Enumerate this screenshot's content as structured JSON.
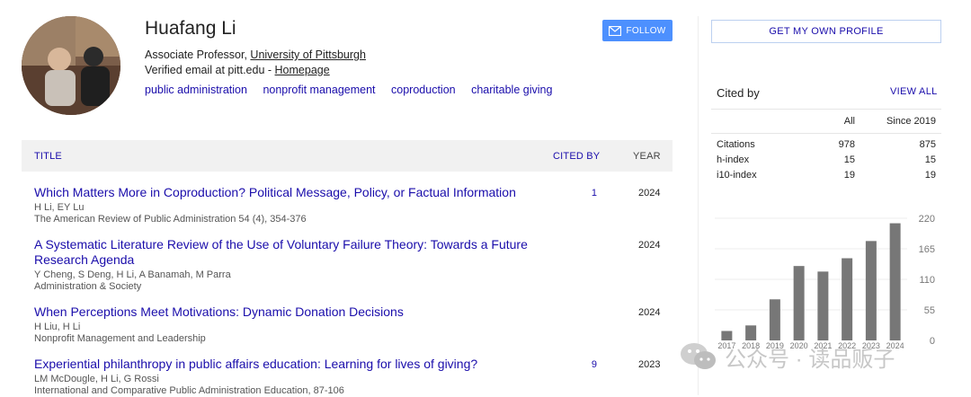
{
  "profile": {
    "name": "Huafang Li",
    "title_prefix": "Associate Professor, ",
    "university": "University of Pittsburgh",
    "email_prefix": "Verified email at pitt.edu - ",
    "homepage": "Homepage",
    "interests": [
      "public administration",
      "nonprofit management",
      "coproduction",
      "charitable giving"
    ],
    "follow_label": "FOLLOW"
  },
  "table": {
    "title_header": "TITLE",
    "cited_header": "CITED BY",
    "year_header": "YEAR",
    "rows": [
      {
        "title": "Which Matters More in Coproduction? Political Message, Policy, or Factual Information",
        "authors": "H Li, EY Lu",
        "venue": "The American Review of Public Administration 54 (4), 354-376",
        "cited": "1",
        "year": "2024"
      },
      {
        "title": "A Systematic Literature Review of the Use of Voluntary Failure Theory: Towards a Future Research Agenda",
        "authors": "Y Cheng, S Deng, H Li, A Banamah, M Parra",
        "venue": "Administration & Society",
        "cited": "",
        "year": "2024"
      },
      {
        "title": "When Perceptions Meet Motivations: Dynamic Donation Decisions",
        "authors": "H Liu, H Li",
        "venue": "Nonprofit Management and Leadership",
        "cited": "",
        "year": "2024"
      },
      {
        "title": "Experiential philanthropy in public affairs education: Learning for lives of giving?",
        "authors": "LM McDougle, H Li, G Rossi",
        "venue": "International and Comparative Public Administration Education, 87-106",
        "cited": "9",
        "year": "2023"
      }
    ]
  },
  "sidebar": {
    "own_profile_label": "GET MY OWN PROFILE",
    "cited_by_label": "Cited by",
    "view_all_label": "VIEW ALL",
    "col_all": "All",
    "col_since": "Since 2019",
    "stats": [
      {
        "label": "Citations",
        "all": "978",
        "since": "875"
      },
      {
        "label": "h-index",
        "all": "15",
        "since": "15"
      },
      {
        "label": "i10-index",
        "all": "19",
        "since": "19"
      }
    ]
  },
  "chart_data": {
    "type": "bar",
    "categories": [
      "2017",
      "2018",
      "2019",
      "2020",
      "2021",
      "2022",
      "2023",
      "2024"
    ],
    "values": [
      17,
      27,
      74,
      134,
      124,
      148,
      179,
      211
    ],
    "yticks": [
      0,
      55,
      110,
      165,
      220
    ],
    "ylim": [
      0,
      220
    ],
    "bar_color": "#777777"
  },
  "watermark": "公众号 · 读品贩子"
}
